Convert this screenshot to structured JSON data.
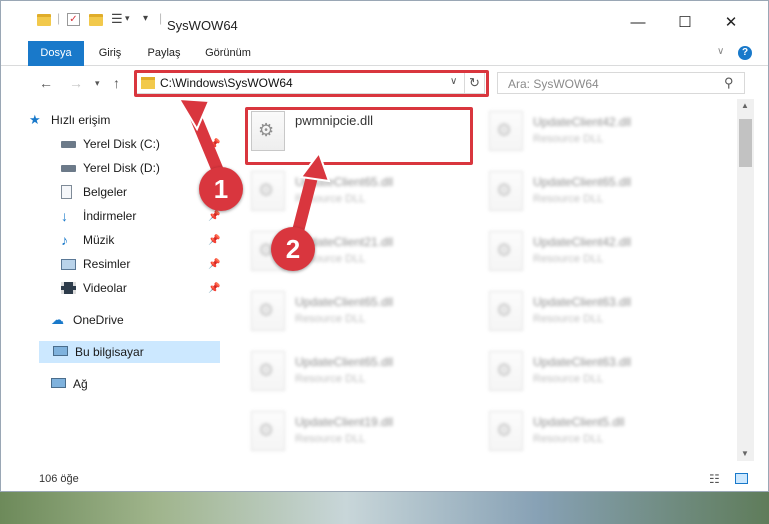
{
  "window": {
    "title": "SysWOW64",
    "controls": {
      "minimize": "—",
      "maximize": "☐",
      "close": "✕"
    }
  },
  "ribbon": {
    "tabs": [
      "Dosya",
      "Giriş",
      "Paylaş",
      "Görünüm"
    ],
    "active_tab": "Dosya",
    "accent_color": "#1979ca"
  },
  "address": {
    "path": "C:\\Windows\\SysWOW64",
    "search_placeholder": "Ara: SysWOW64"
  },
  "sidebar": {
    "quick_access": "Hızlı erişim",
    "items": [
      {
        "label": "Yerel Disk (C:)",
        "icon": "drive-icon",
        "pinned": true
      },
      {
        "label": "Yerel Disk (D:)",
        "icon": "drive-icon",
        "pinned": false
      },
      {
        "label": "Belgeler",
        "icon": "documents-icon",
        "pinned": true
      },
      {
        "label": "İndirmeler",
        "icon": "download-icon",
        "pinned": true
      },
      {
        "label": "Müzik",
        "icon": "music-icon",
        "pinned": true
      },
      {
        "label": "Resimler",
        "icon": "pictures-icon",
        "pinned": true
      },
      {
        "label": "Videolar",
        "icon": "videos-icon",
        "pinned": true
      }
    ],
    "onedrive": "OneDrive",
    "this_pc": "Bu bilgisayar",
    "network": "Ağ",
    "selected": "Bu bilgisayar"
  },
  "files": {
    "highlighted": {
      "name": "pwmnipcie.dll"
    },
    "others": [
      {
        "name": "UpdateClient42.dll",
        "type": "Resource DLL"
      },
      {
        "name": "UpdateClient65.dll",
        "type": "Resource DLL"
      },
      {
        "name": "UpdateClient65.dll",
        "type": "Resource DLL"
      },
      {
        "name": "UpdateClient21.dll",
        "type": "Resource DLL"
      },
      {
        "name": "UpdateClient42.dll",
        "type": "Resource DLL"
      },
      {
        "name": "UpdateClient65.dll",
        "type": "Resource DLL"
      },
      {
        "name": "UpdateClient63.dll",
        "type": "Resource DLL"
      },
      {
        "name": "UpdateClient65.dll",
        "type": "Resource DLL"
      },
      {
        "name": "UpdateClient63.dll",
        "type": "Resource DLL"
      },
      {
        "name": "UpdateClient19.dll",
        "type": "Resource DLL"
      },
      {
        "name": "UpdateClient5.dll",
        "type": "Resource DLL"
      }
    ]
  },
  "status": {
    "count": "106 öğe"
  },
  "callouts": {
    "step1": "1",
    "step2": "2",
    "color": "#d9363e"
  }
}
